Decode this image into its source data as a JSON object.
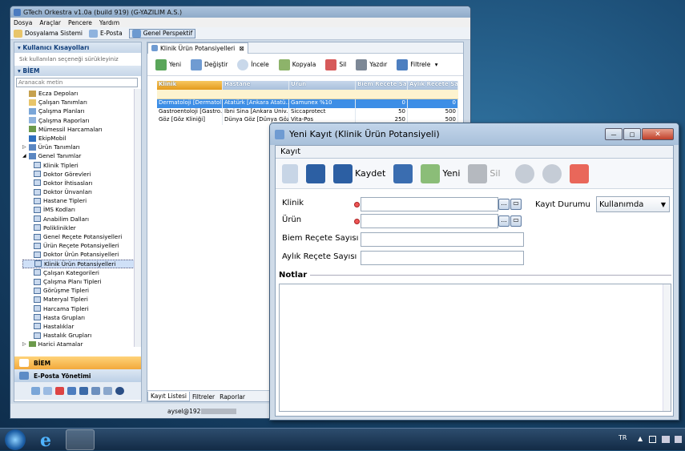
{
  "app": {
    "title": "GTech Orkestra v1.0a (build 919) (G-YAZILIM A.S.)"
  },
  "menu": [
    "Dosya",
    "Araçlar",
    "Pencere",
    "Yardım"
  ],
  "toolbar": {
    "files": "Dosyalama Sistemi",
    "email": "E-Posta",
    "perspective": "Genel Perspektif"
  },
  "left": {
    "header": "Kullanıcı Kısayolları",
    "hint": "Sık kullanılan seçeneği sürükleyiniz",
    "section": "BİEM",
    "search_placeholder": "Aranacak metin",
    "tree": [
      "Ecza Depoları",
      "Çalışan Tanımları",
      "Çalışma Planları",
      "Çalışma Raporları",
      "Mümessil Harcamaları",
      "EkipMobil",
      "Ürün Tanımları",
      "Genel Tanımlar",
      "Klinik Tipleri",
      "Doktor Görevleri",
      "Doktor İhtisasları",
      "Doktor Ünvanları",
      "Hastane Tipleri",
      "İMS Kodları",
      "Anabilim Dalları",
      "Poliklinikler",
      "Genel Reçete Potansiyelleri",
      "Ürün Reçete Potansiyelleri",
      "Doktor Ürün Potansiyelleri",
      "Klinik Ürün Potansiyelleri",
      "Çalışan Kategorileri",
      "Çalışma Planı Tipleri",
      "Görüşme Tipleri",
      "Materyal Tipleri",
      "Harcama Tipleri",
      "Hasta Grupları",
      "Hastalıklar",
      "Hastalık Grupları",
      "Harici Atamalar"
    ],
    "bottom1": "BİEM",
    "bottom2": "E-Posta Yönetimi"
  },
  "center": {
    "tab": "Klinik Ürün Potansiyelleri",
    "actions": [
      "Yeni",
      "Değiştir",
      "İncele",
      "Kopyala",
      "Sil",
      "Yazdır",
      "Filtrele"
    ],
    "columns": [
      "Klinik",
      "Hastane",
      "Ürün",
      "Biem Reçete Sa...",
      "Aylık Reçete Sa..."
    ],
    "rows": [
      [
        "Dermatoloji [Dermatol...",
        "Atatürk [Ankara Atatü...",
        "Gamunex %10",
        "0",
        "0"
      ],
      [
        "Gastroentoloji [Gastro...",
        "İbni Sina [Ankara Üniv...",
        "Siccaprotect",
        "50",
        "500"
      ],
      [
        "Göz [Göz Kliniği]",
        "Dünya Göz [Dünya Göz...",
        "Vita-Pos",
        "250",
        "500"
      ]
    ],
    "bottom_tabs": [
      "Kayıt Listesi",
      "Filtreler",
      "Raporlar"
    ],
    "status_user": "aysel@192"
  },
  "dialog": {
    "title": "Yeni Kayıt (Klinik Ürün Potansiyeli)",
    "menu": "Kayıt",
    "save_label": "Kaydet",
    "new_label": "Yeni",
    "delete_label": "Sil",
    "klinik_label": "Klinik",
    "urun_label": "Ürün",
    "biem_label": "Biem Reçete Sayısı",
    "aylik_label": "Aylık Reçete Sayısı",
    "status_label": "Kayıt Durumu",
    "status_value": "Kullanımda",
    "notes_label": "Notlar",
    "dots": "..."
  },
  "taskbar": {
    "lang": "TR"
  }
}
